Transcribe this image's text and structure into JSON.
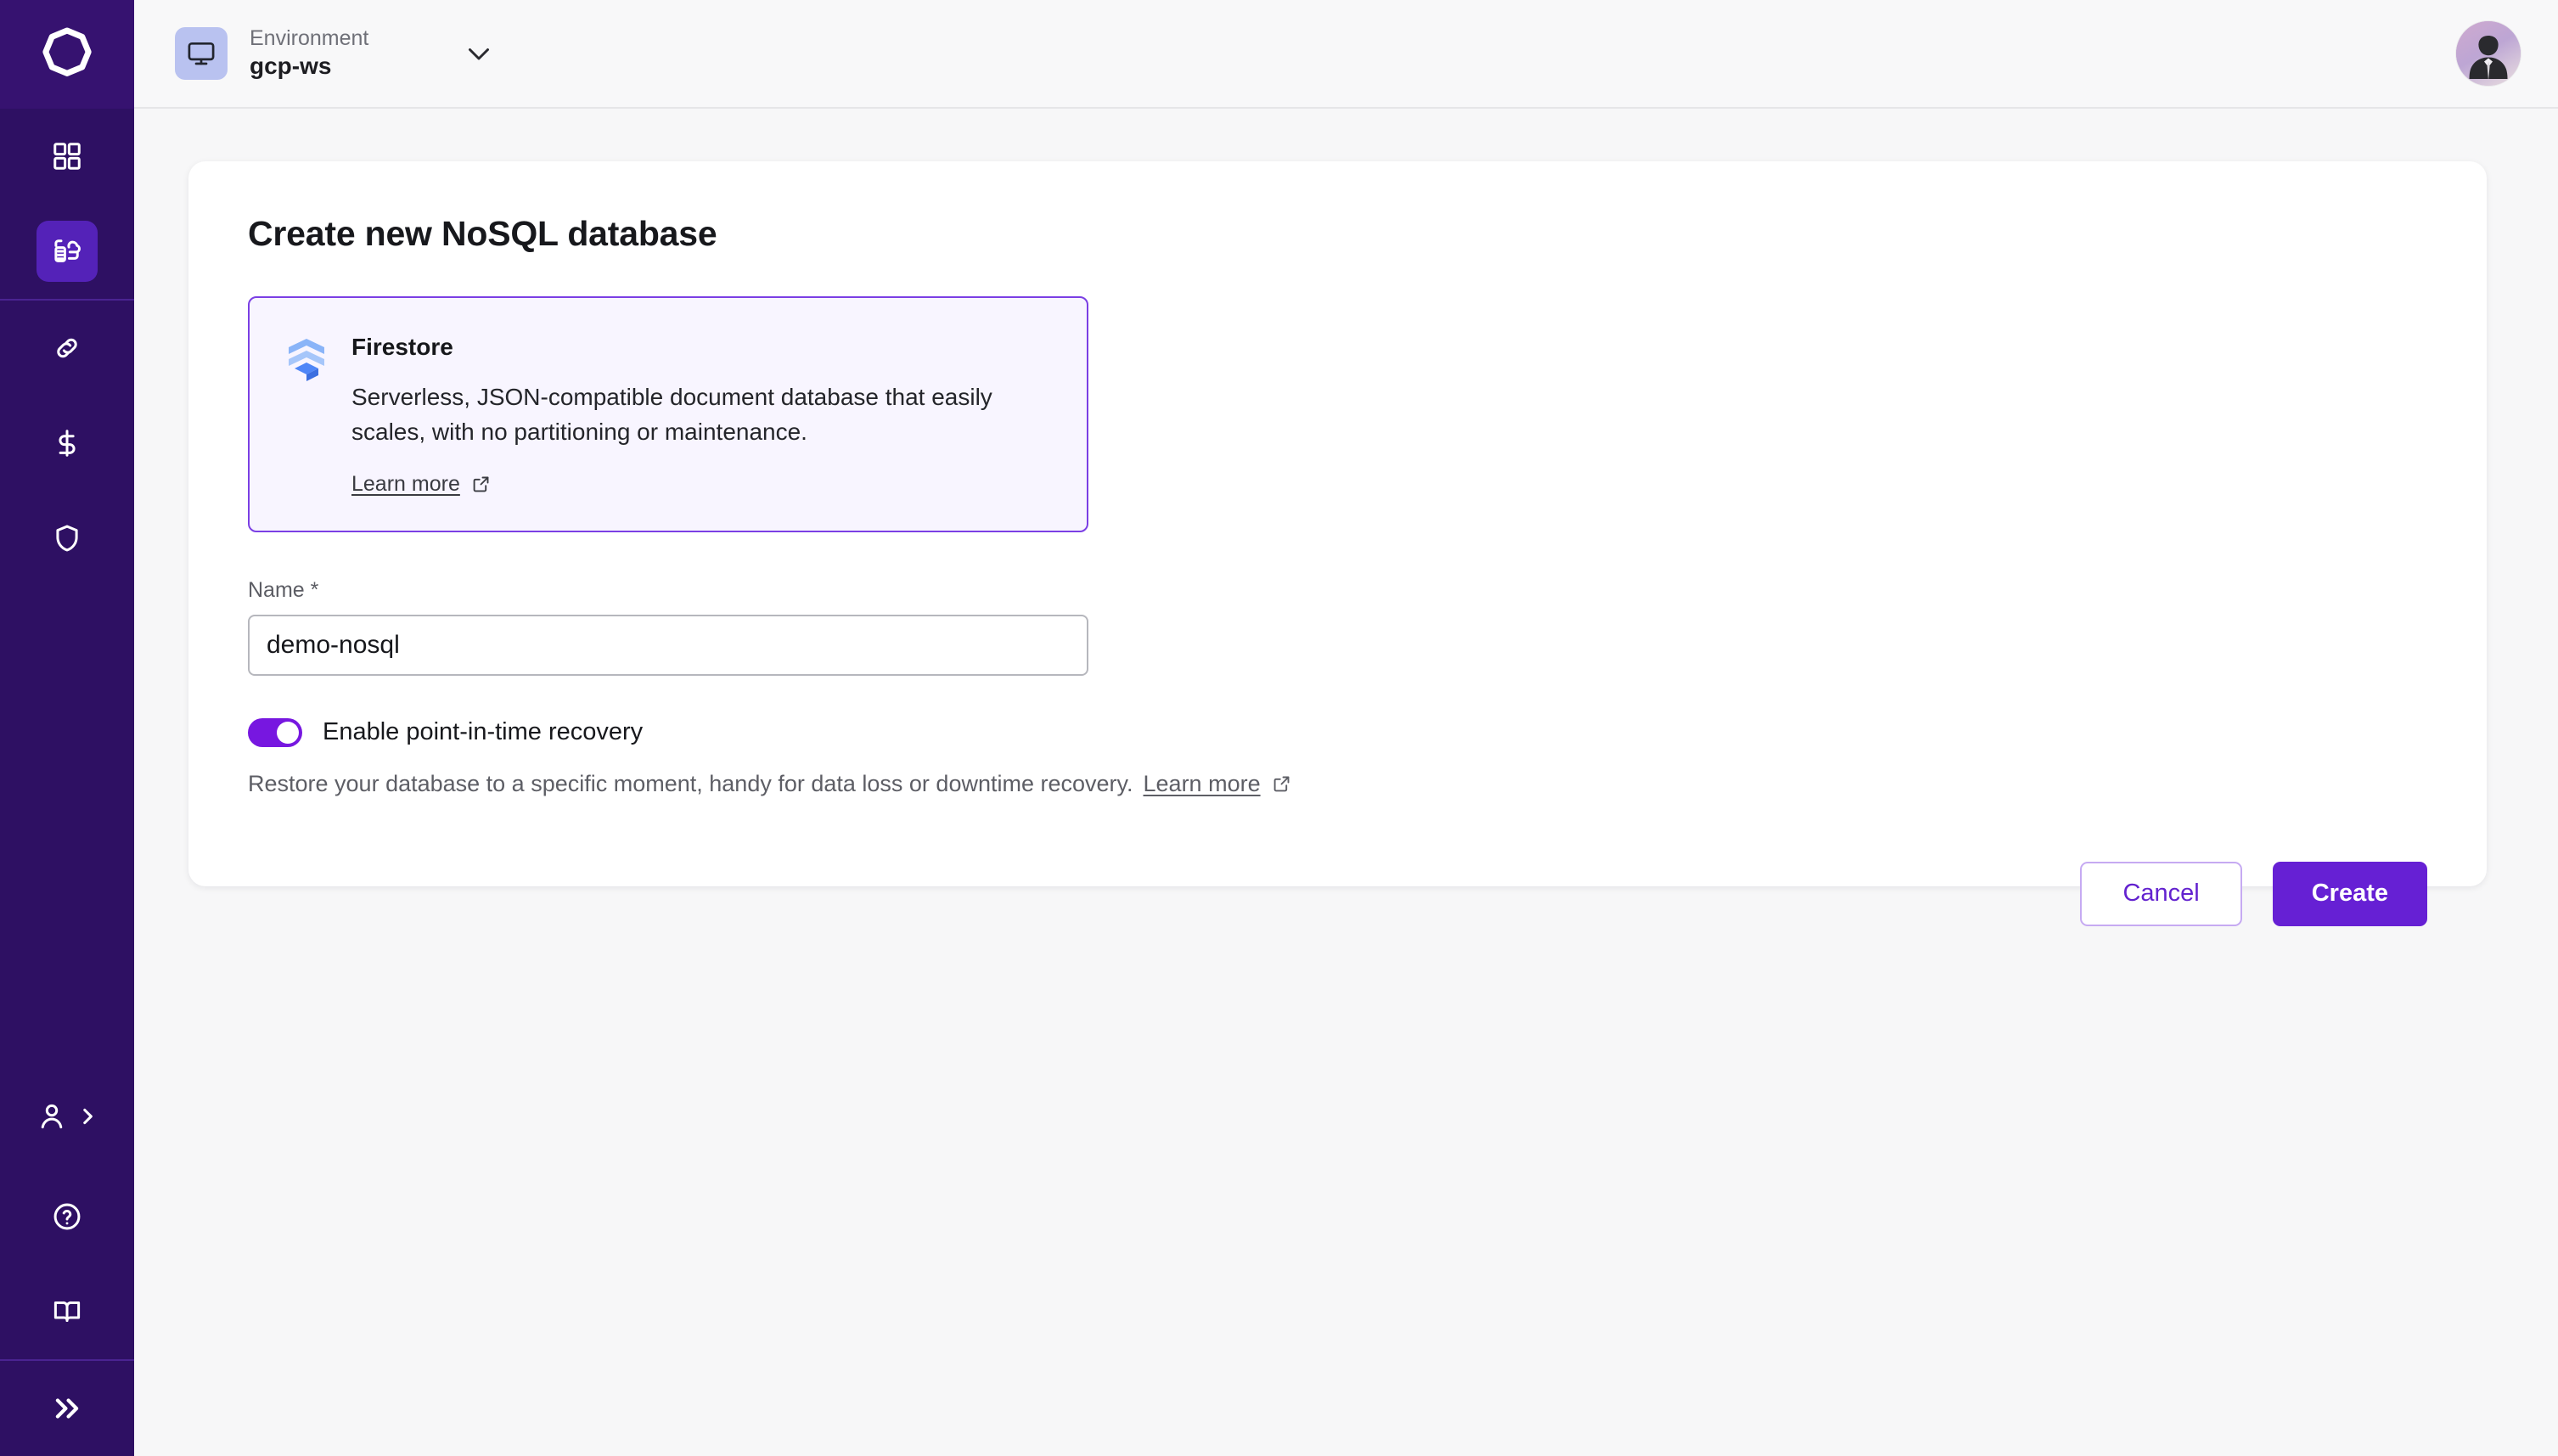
{
  "brand": {
    "logo_icon": "octagon-ring-logo",
    "sidebar_bg": "#2e1063",
    "accent": "#6620d4",
    "accent_light": "#7717e0"
  },
  "sidebar": {
    "items": [
      {
        "id": "dashboard",
        "icon": "grid-dashboard-icon",
        "active": false
      },
      {
        "id": "databases",
        "icon": "database-cloud-icon",
        "active": true
      },
      {
        "id": "connections",
        "icon": "link-chain-icon",
        "active": false
      },
      {
        "id": "billing",
        "icon": "dollar-sign-icon",
        "active": false
      },
      {
        "id": "security",
        "icon": "shield-icon",
        "active": false
      }
    ],
    "footer_items": [
      {
        "id": "account",
        "icon": "user-icon",
        "secondary_icon": "chevron-right-icon"
      },
      {
        "id": "help",
        "icon": "question-circle-icon"
      },
      {
        "id": "docs",
        "icon": "book-open-icon"
      },
      {
        "id": "expand",
        "icon": "chevrons-right-icon"
      }
    ]
  },
  "topbar": {
    "env_icon": "monitor-icon",
    "env_label": "Environment",
    "env_value": "gcp-ws",
    "chevron_icon": "chevron-down-icon",
    "avatar_icon": "user-avatar"
  },
  "main": {
    "title": "Create new NoSQL database",
    "product": {
      "icon": "firestore-chevrons-icon",
      "name": "Firestore",
      "description": "Serverless, JSON-compatible document database that easily scales, with no partitioning or maintenance.",
      "learn_more": "Learn more",
      "external_icon": "external-link-icon",
      "selected": true
    },
    "name_field": {
      "label": "Name *",
      "value": "demo-nosql",
      "placeholder": "Name"
    },
    "pitr": {
      "toggle_label": "Enable point-in-time recovery",
      "enabled": true,
      "helper_text": "Restore your database to a specific moment, handy for data loss or downtime recovery.",
      "learn_more": "Learn more",
      "external_icon": "external-link-icon"
    },
    "actions": {
      "cancel_label": "Cancel",
      "create_label": "Create"
    }
  }
}
